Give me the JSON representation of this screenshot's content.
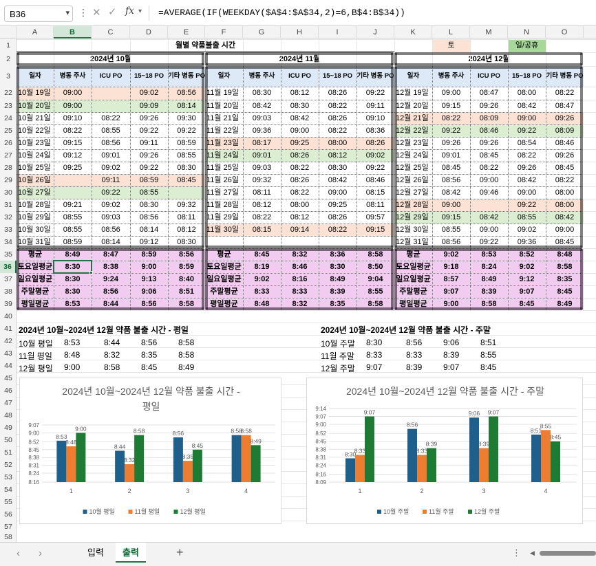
{
  "formula_bar": {
    "cell_ref": "B36",
    "formula": "=AVERAGE(IF(WEEKDAY($A$4:$A$34,2)=6,B$4:B$34))"
  },
  "columns": [
    "A",
    "B",
    "C",
    "D",
    "E",
    "F",
    "G",
    "H",
    "I",
    "J",
    "K",
    "L",
    "M",
    "N",
    "O"
  ],
  "selected_column": "B",
  "rows": [
    "1",
    "2",
    "3",
    "22",
    "23",
    "24",
    "25",
    "26",
    "27",
    "28",
    "29",
    "30",
    "31",
    "32",
    "33",
    "34",
    "35",
    "36",
    "37",
    "38",
    "39",
    "40",
    "41",
    "42",
    "43",
    "44",
    "45",
    "46",
    "47",
    "48",
    "49",
    "50",
    "51",
    "52",
    "53",
    "54",
    "55",
    "56",
    "57",
    "58"
  ],
  "selected_row": "36",
  "title": "월별 약품불출 시간",
  "legend_sat": "토",
  "legend_sun": "일/공휴",
  "colors": {
    "sat": "#fbe2d5",
    "sun": "#dbeed2",
    "legend_sun": "#a7d89a",
    "summary": "#f2ccf0",
    "header": "#dde9f7",
    "select": "#217346"
  },
  "months": [
    {
      "name": "2024년 10월",
      "rows": [
        [
          "10월 19일",
          "09:00",
          "",
          "09:02",
          "08:56",
          "sat"
        ],
        [
          "10월 20일",
          "09:00",
          "",
          "09:09",
          "08:14",
          "sun"
        ],
        [
          "10월 21일",
          "09:10",
          "08:22",
          "09:26",
          "09:30",
          ""
        ],
        [
          "10월 22일",
          "08:22",
          "08:55",
          "09:22",
          "09:22",
          ""
        ],
        [
          "10월 23일",
          "09:15",
          "08:56",
          "09:11",
          "08:59",
          ""
        ],
        [
          "10월 24일",
          "09:12",
          "09:01",
          "09:26",
          "08:55",
          ""
        ],
        [
          "10월 25일",
          "09:25",
          "09:02",
          "09:22",
          "08:30",
          ""
        ],
        [
          "10월 26일",
          "",
          "09:11",
          "08:59",
          "08:45",
          "sat"
        ],
        [
          "10월 27일",
          "",
          "09:22",
          "08:55",
          "",
          "sun"
        ],
        [
          "10월 28일",
          "09:21",
          "09:02",
          "08:30",
          "09:32",
          ""
        ],
        [
          "10월 29일",
          "08:55",
          "09:03",
          "08:56",
          "08:11",
          ""
        ],
        [
          "10월 30일",
          "08:55",
          "08:56",
          "08:14",
          "08:12",
          ""
        ],
        [
          "10월 31일",
          "08:59",
          "08:14",
          "09:12",
          "08:30",
          ""
        ]
      ],
      "summary": [
        [
          "평균",
          "8:49",
          "8:47",
          "8:59",
          "8:56"
        ],
        [
          "토요일평균",
          "8:30",
          "8:38",
          "9:00",
          "8:59"
        ],
        [
          "일요일평균",
          "8:30",
          "9:24",
          "9:13",
          "8:40"
        ],
        [
          "주말평균",
          "8:30",
          "8:56",
          "9:06",
          "8:51"
        ],
        [
          "평일평균",
          "8:53",
          "8:44",
          "8:56",
          "8:58"
        ]
      ]
    },
    {
      "name": "2024년 11월",
      "rows": [
        [
          "11월 19일",
          "08:30",
          "08:12",
          "08:26",
          "09:22",
          ""
        ],
        [
          "11월 20일",
          "08:42",
          "08:30",
          "08:22",
          "09:11",
          ""
        ],
        [
          "11월 21일",
          "09:03",
          "08:42",
          "08:26",
          "09:10",
          ""
        ],
        [
          "11월 22일",
          "09:36",
          "09:00",
          "08:22",
          "08:36",
          ""
        ],
        [
          "11월 23일",
          "08:17",
          "09:25",
          "08:00",
          "08:26",
          "sat"
        ],
        [
          "11월 24일",
          "09:01",
          "08:26",
          "08:12",
          "09:02",
          "sun"
        ],
        [
          "11월 25일",
          "09:03",
          "08:22",
          "08:30",
          "09:22",
          ""
        ],
        [
          "11월 26일",
          "09:32",
          "08:26",
          "08:42",
          "08:46",
          ""
        ],
        [
          "11월 27일",
          "08:11",
          "08:22",
          "09:00",
          "08:15",
          ""
        ],
        [
          "11월 28일",
          "08:12",
          "08:00",
          "09:25",
          "08:11",
          ""
        ],
        [
          "11월 29일",
          "08:22",
          "08:12",
          "08:26",
          "09:57",
          ""
        ],
        [
          "11월 30일",
          "08:15",
          "09:14",
          "08:22",
          "09:15",
          "sat"
        ],
        [
          "",
          "",
          "",
          "",
          "",
          ""
        ]
      ],
      "summary": [
        [
          "평균",
          "8:45",
          "8:32",
          "8:36",
          "8:58"
        ],
        [
          "토요일평균",
          "8:19",
          "8:46",
          "8:30",
          "8:50"
        ],
        [
          "일요일평균",
          "9:02",
          "8:16",
          "8:49",
          "9:04"
        ],
        [
          "주말평균",
          "8:33",
          "8:33",
          "8:39",
          "8:55"
        ],
        [
          "평일평균",
          "8:48",
          "8:32",
          "8:35",
          "8:58"
        ]
      ]
    },
    {
      "name": "2024년 12월",
      "rows": [
        [
          "12월 19일",
          "09:00",
          "08:47",
          "08:00",
          "08:22",
          ""
        ],
        [
          "12월 20일",
          "09:15",
          "09:26",
          "08:42",
          "08:47",
          ""
        ],
        [
          "12월 21일",
          "08:22",
          "08:09",
          "09:00",
          "09:26",
          "sat"
        ],
        [
          "12월 22일",
          "09:22",
          "08:46",
          "09:22",
          "08:09",
          "sun"
        ],
        [
          "12월 23일",
          "09:26",
          "09:26",
          "08:54",
          "08:46",
          ""
        ],
        [
          "12월 24일",
          "09:01",
          "08:45",
          "08:22",
          "09:26",
          ""
        ],
        [
          "12월 25일",
          "08:45",
          "08:22",
          "09:26",
          "08:45",
          ""
        ],
        [
          "12월 26일",
          "08:56",
          "09:00",
          "08:42",
          "08:22",
          ""
        ],
        [
          "12월 27일",
          "08:42",
          "09:46",
          "09:00",
          "08:00",
          ""
        ],
        [
          "12월 28일",
          "09:00",
          "",
          "09:22",
          "08:00",
          "sat"
        ],
        [
          "12월 29일",
          "09:15",
          "08:42",
          "08:55",
          "08:42",
          "sun"
        ],
        [
          "12월 30일",
          "08:55",
          "09:00",
          "09:02",
          "09:00",
          ""
        ],
        [
          "12월 31일",
          "08:56",
          "09:22",
          "09:36",
          "08:45",
          ""
        ]
      ],
      "summary": [
        [
          "평균",
          "9:02",
          "8:53",
          "8:52",
          "8:48"
        ],
        [
          "토요일평균",
          "9:18",
          "8:24",
          "9:02",
          "8:58"
        ],
        [
          "일요일평균",
          "8:57",
          "8:49",
          "9:12",
          "8:35"
        ],
        [
          "주말평균",
          "9:07",
          "8:39",
          "9:07",
          "8:45"
        ],
        [
          "평일평균",
          "9:00",
          "8:58",
          "8:45",
          "8:49"
        ]
      ]
    }
  ],
  "col_headers": [
    "일자",
    "병동 주사",
    "ICU PO",
    "15~18 PO",
    "기타 병동 PO"
  ],
  "summary_weekday": {
    "title": "2024년 10월~2024년 12월 약품 불출 시간 - 평일",
    "rows": [
      [
        "10월 평일",
        "8:53",
        "8:44",
        "8:56",
        "8:58"
      ],
      [
        "11월 평일",
        "8:48",
        "8:32",
        "8:35",
        "8:58"
      ],
      [
        "12월 평일",
        "9:00",
        "8:58",
        "8:45",
        "8:49"
      ]
    ]
  },
  "summary_weekend": {
    "title": "2024년 10월~2024년 12월 약품 불출 시간 - 주말",
    "rows": [
      [
        "10월 주말",
        "8:30",
        "8:56",
        "9:06",
        "8:51"
      ],
      [
        "11월 주말",
        "8:33",
        "8:33",
        "8:39",
        "8:55"
      ],
      [
        "12월 주말",
        "9:07",
        "8:39",
        "9:07",
        "8:45"
      ]
    ]
  },
  "chart_data": [
    {
      "type": "bar",
      "title": "2024년 10월~2024년 12월 약품 불출 시간 - 평일",
      "categories": [
        "1",
        "2",
        "3",
        "4"
      ],
      "yticks": [
        "8:16",
        "8:24",
        "8:31",
        "8:38",
        "8:45",
        "8:52",
        "9:00",
        "9:07"
      ],
      "ylim": [
        "8:16",
        "9:07"
      ],
      "series": [
        {
          "name": "10월 평일",
          "color": "#1f5f8b",
          "values": [
            "8:53",
            "8:44",
            "8:56",
            "8:58"
          ]
        },
        {
          "name": "11월 평일",
          "color": "#ed7d31",
          "values": [
            "8:48",
            "8:32",
            "8:35",
            "8:58"
          ]
        },
        {
          "name": "12월 평일",
          "color": "#1e7b34",
          "values": [
            "9:00",
            "8:58",
            "8:45",
            "8:49"
          ]
        }
      ],
      "legend": "bottom",
      "grid": true
    },
    {
      "type": "bar",
      "title": "2024년 10월~2024년 12월 약품 불출 시간 - 주말",
      "categories": [
        "1",
        "2",
        "3",
        "4"
      ],
      "yticks": [
        "8:09",
        "8:16",
        "8:24",
        "8:31",
        "8:38",
        "8:45",
        "8:52",
        "9:00",
        "9:07",
        "9:14"
      ],
      "ylim": [
        "8:09",
        "9:14"
      ],
      "series": [
        {
          "name": "10월 주말",
          "color": "#1f5f8b",
          "values": [
            "8:30",
            "8:56",
            "9:06",
            "8:51"
          ]
        },
        {
          "name": "11월 주말",
          "color": "#ed7d31",
          "values": [
            "8:33",
            "8:33",
            "8:39",
            "8:55"
          ]
        },
        {
          "name": "12월 주말",
          "color": "#1e7b34",
          "values": [
            "9:07",
            "8:39",
            "9:07",
            "8:45"
          ]
        }
      ],
      "legend": "bottom",
      "grid": true
    }
  ],
  "sheet_tabs": [
    "입력",
    "출력"
  ]
}
